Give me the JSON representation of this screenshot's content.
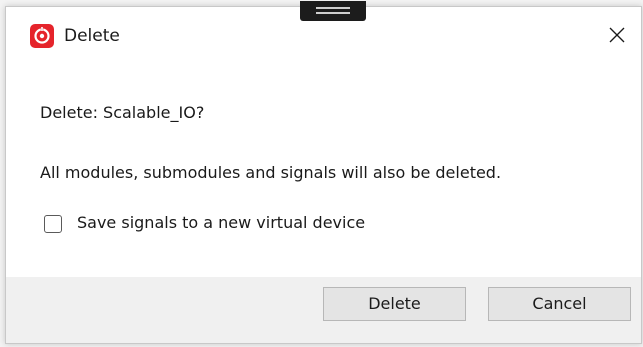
{
  "window": {
    "title": "Delete",
    "app_icon": "app-logo-icon",
    "close_icon": "close-icon",
    "accent_color": "#e5242b"
  },
  "dialog": {
    "message": "Delete: Scalable_IO?",
    "warning": "All modules, submodules and signals will also be deleted.",
    "checkbox": {
      "label": "Save signals to a new virtual device",
      "checked": false
    }
  },
  "buttons": {
    "delete_label": "Delete",
    "cancel_label": "Cancel"
  }
}
